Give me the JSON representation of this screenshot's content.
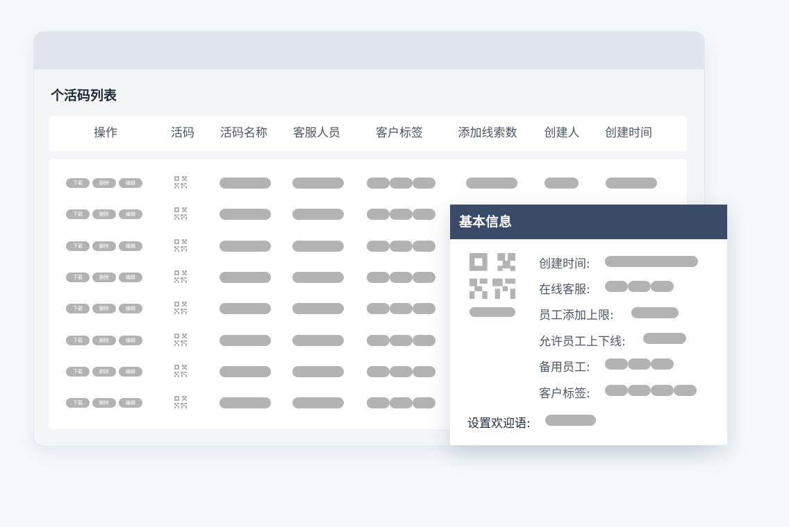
{
  "list": {
    "title": "个活码列表",
    "columns": [
      "操作",
      "活码",
      "活码名称",
      "客服人员",
      "客户标签",
      "添加线索数",
      "创建人",
      "创建时间"
    ],
    "row_actions": [
      "下载",
      "删除",
      "编辑"
    ],
    "row_count": 8
  },
  "detail": {
    "title": "基本信息",
    "fields": [
      "创建时间:",
      "在线客服:",
      "员工添加上限:",
      "允许员工上下线:",
      "备用员工:",
      "客户标签:"
    ],
    "welcome_label": "设置欢迎语:"
  },
  "colors": {
    "panel_header": "#3a4b67",
    "placeholder": "#b3b3b3",
    "titlebar": "#e0e5ee"
  }
}
